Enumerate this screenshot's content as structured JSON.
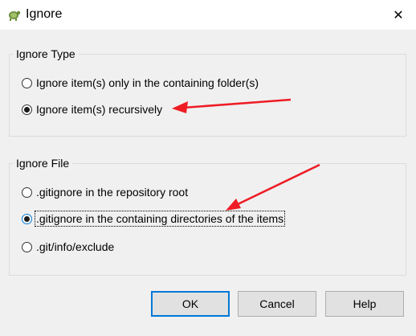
{
  "window": {
    "title": "Ignore",
    "close_glyph": "✕"
  },
  "ignore_type": {
    "legend": "Ignore Type",
    "options": [
      {
        "label": "Ignore item(s) only in the containing folder(s)",
        "checked": false
      },
      {
        "label": "Ignore item(s) recursively",
        "checked": true
      }
    ]
  },
  "ignore_file": {
    "legend": "Ignore File",
    "options": [
      {
        "label": ".gitignore in the repository root",
        "checked": false
      },
      {
        "label": ".gitignore in the containing directories of the items",
        "checked": true
      },
      {
        "label": ".git/info/exclude",
        "checked": false
      }
    ]
  },
  "buttons": {
    "ok": "OK",
    "cancel": "Cancel",
    "help": "Help"
  },
  "colors": {
    "accent": "#0078d7",
    "annotation_arrow": "#ee1c24"
  }
}
